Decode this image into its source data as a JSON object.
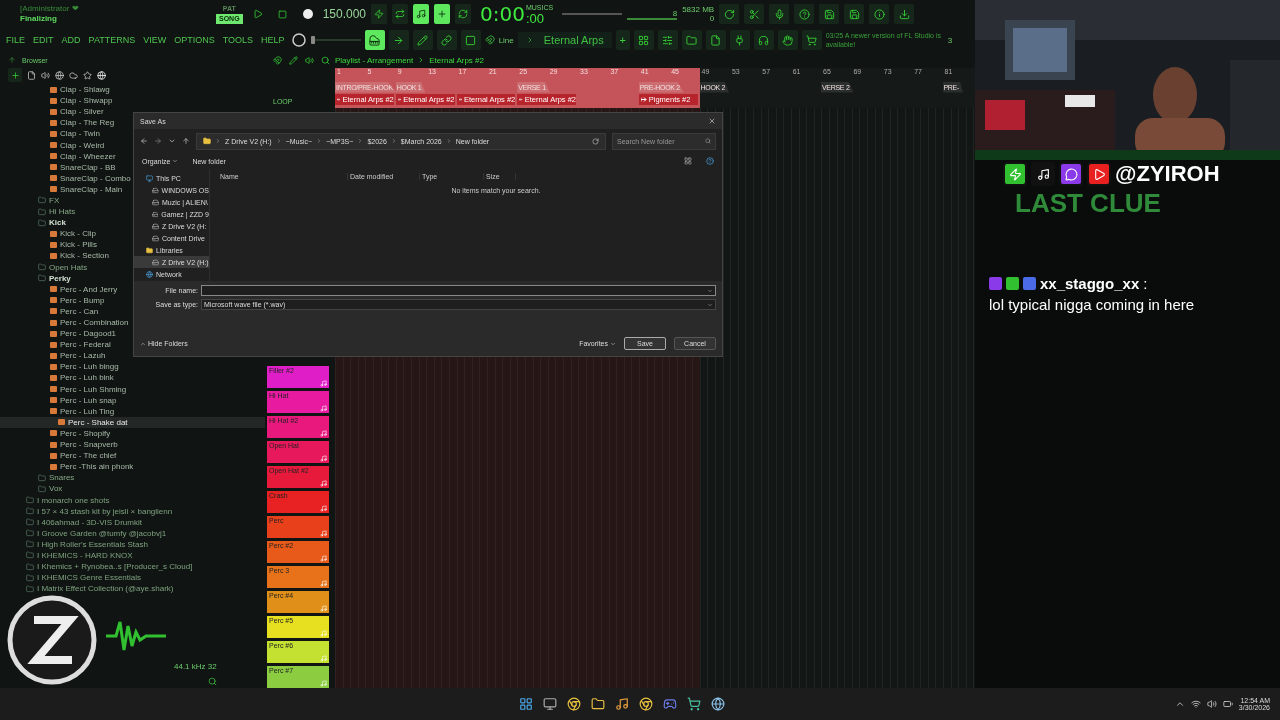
{
  "titlebar": {
    "user": "[Administrator ❤",
    "status": "Finalizing"
  },
  "transport": {
    "modes": [
      {
        "label": "PAT",
        "selected": false
      },
      {
        "label": "SONG",
        "selected": true
      }
    ],
    "tempo": "150.000",
    "time": "0:00",
    "time_small": ":00",
    "time_label": "MUSICS",
    "master_volume": {
      "level": 1
    },
    "cpu": "8",
    "memory": "5832 MB",
    "poly": "0"
  },
  "menu": [
    "FILE",
    "EDIT",
    "ADD",
    "PATTERNS",
    "VIEW",
    "OPTIONS",
    "TOOLS",
    "HELP"
  ],
  "toolbar": {
    "pitch": {
      "level": 0
    },
    "snap": "Line",
    "pattern": "Eternal Arps",
    "add": "+",
    "news_date": "03/25",
    "news": "A newer version of FL Studio is available!",
    "news_count": "3"
  },
  "browser": {
    "title": "Browser",
    "tree": [
      {
        "label": "Clap - Shlawg",
        "kind": "file",
        "selected": false
      },
      {
        "label": "Clap - Shwapp",
        "kind": "file",
        "selected": false
      },
      {
        "label": "Clap - Silver",
        "kind": "file",
        "selected": false
      },
      {
        "label": "Clap - The Reg",
        "kind": "file",
        "selected": false
      },
      {
        "label": "Clap - Twin",
        "kind": "file",
        "selected": false
      },
      {
        "label": "Clap - Weird",
        "kind": "file",
        "selected": false
      },
      {
        "label": "Clap - Wheezer",
        "kind": "file",
        "selected": false
      },
      {
        "label": "SnareClap - BB",
        "kind": "file",
        "selected": false
      },
      {
        "label": "SnareClap - Combo",
        "kind": "file",
        "selected": false
      },
      {
        "label": "SnareClap - Main",
        "kind": "file",
        "selected": false
      },
      {
        "label": "FX",
        "kind": "folder",
        "expanded": false
      },
      {
        "label": "Hi Hats",
        "kind": "folder",
        "expanded": false
      },
      {
        "label": "Kick",
        "kind": "folder",
        "expanded": true,
        "children": [
          {
            "label": "Kick - Clip",
            "kind": "file",
            "selected": false
          },
          {
            "label": "Kick - Pills",
            "kind": "file",
            "selected": false
          },
          {
            "label": "Kick - Section",
            "kind": "file",
            "selected": false
          }
        ]
      },
      {
        "label": "Open Hats",
        "kind": "folder",
        "expanded": false
      },
      {
        "label": "Perky",
        "kind": "folder",
        "expanded": true,
        "children": [
          {
            "label": "Perc - And Jerry",
            "kind": "file",
            "selected": false
          },
          {
            "label": "Perc - Bump",
            "kind": "file",
            "selected": false
          },
          {
            "label": "Perc - Can",
            "kind": "file",
            "selected": false
          },
          {
            "label": "Perc - Combination",
            "kind": "file",
            "selected": false
          },
          {
            "label": "Perc - Dagood1",
            "kind": "file",
            "selected": false
          },
          {
            "label": "Perc - Federal",
            "kind": "file",
            "selected": false
          },
          {
            "label": "Perc - Lazuh",
            "kind": "file",
            "selected": false
          },
          {
            "label": "Perc - Luh bingg",
            "kind": "file",
            "selected": false
          },
          {
            "label": "Perc - Luh bink",
            "kind": "file",
            "selected": false
          },
          {
            "label": "Perc - Luh Shming",
            "kind": "file",
            "selected": false
          },
          {
            "label": "Perc - Luh snap",
            "kind": "file",
            "selected": false
          },
          {
            "label": "Perc - Luh Ting",
            "kind": "file",
            "selected": false
          },
          {
            "label": "Perc - Shake dat",
            "kind": "file",
            "selected": true
          },
          {
            "label": "Perc - Shopify",
            "kind": "file",
            "selected": false
          },
          {
            "label": "Perc - Snapverb",
            "kind": "file",
            "selected": false
          },
          {
            "label": "Perc - The chief",
            "kind": "file",
            "selected": false
          },
          {
            "label": "Perc -This ain phonk",
            "kind": "file",
            "selected": false
          }
        ]
      },
      {
        "label": "Snares",
        "kind": "folder",
        "expanded": false
      },
      {
        "label": "Vox",
        "kind": "folder",
        "expanded": false
      },
      {
        "label": "I monarch one shots",
        "kind": "pack"
      },
      {
        "label": "I 57 × 43 stash kit by jeisli × banglienn",
        "kind": "pack"
      },
      {
        "label": "I 406ahmad - 3D-VIS Drumkit",
        "kind": "pack"
      },
      {
        "label": "I Groove Garden @tumfy @jacobvj1",
        "kind": "pack"
      },
      {
        "label": "I High Roller's Essentials Stash",
        "kind": "pack"
      },
      {
        "label": "I KHEMICS - HARD KNOX",
        "kind": "pack"
      },
      {
        "label": "I Khemics + Rynobea..s [Producer_s Cloud]",
        "kind": "pack"
      },
      {
        "label": "I KHEMICS Genre Essentials",
        "kind": "pack"
      },
      {
        "label": "I Matrix Effect Collection (@aye.shark)",
        "kind": "pack"
      }
    ],
    "sample_rate": "44.1 kHz 32"
  },
  "playlist": {
    "title": "Playlist - Arrangement",
    "pattern": "Eternal Arps #2",
    "loop_label": "LOOP",
    "bars": [
      {
        "number": "1",
        "highlighted": true,
        "marker": "INTRO/PRE-HOOK",
        "clip": "Eternal Arps #2"
      },
      {
        "number": "5",
        "highlighted": true
      },
      {
        "number": "9",
        "highlighted": true,
        "marker": "HOOK 1",
        "clip": "Eternal Arps #2"
      },
      {
        "number": "13",
        "highlighted": true
      },
      {
        "number": "17",
        "highlighted": true,
        "clip": "Eternal Arps #2"
      },
      {
        "number": "21",
        "highlighted": true
      },
      {
        "number": "25",
        "highlighted": true,
        "marker": "VERSE 1",
        "clip": "Eternal Arps #2"
      },
      {
        "number": "29",
        "highlighted": true
      },
      {
        "number": "33",
        "highlighted": true
      },
      {
        "number": "37",
        "highlighted": true
      },
      {
        "number": "41",
        "highlighted": true,
        "marker": "PRE-HOOK 2",
        "clip": "Pigments #2"
      },
      {
        "number": "45",
        "highlighted": true
      },
      {
        "number": "49",
        "highlighted": false,
        "marker": "HOOK 2"
      },
      {
        "number": "53",
        "highlighted": false
      },
      {
        "number": "57",
        "highlighted": false
      },
      {
        "number": "61",
        "highlighted": false
      },
      {
        "number": "65",
        "highlighted": false,
        "marker": "VERSE 2"
      },
      {
        "number": "69",
        "highlighted": false
      },
      {
        "number": "73",
        "highlighted": false
      },
      {
        "number": "77",
        "highlighted": false
      },
      {
        "number": "81",
        "highlighted": false,
        "marker": "PRE-"
      }
    ]
  },
  "channels": [
    {
      "name": "Filler #2",
      "color": "#e01ec8"
    },
    {
      "name": "Hi Hat",
      "color": "#e81aa0"
    },
    {
      "name": "Hi Hat #2",
      "color": "#e8187c"
    },
    {
      "name": "Open Hat",
      "color": "#e8185c"
    },
    {
      "name": "Open Hat #2",
      "color": "#e81a3c"
    },
    {
      "name": "Crash",
      "color": "#e82222"
    },
    {
      "name": "Perc",
      "color": "#e8401a"
    },
    {
      "name": "Perc #2",
      "color": "#e85a1a"
    },
    {
      "name": "Perc 3",
      "color": "#e8721a"
    },
    {
      "name": "Perc #4",
      "color": "#e09018"
    },
    {
      "name": "Perc #5",
      "color": "#e6e020"
    },
    {
      "name": "Perc #6",
      "color": "#c4e030"
    },
    {
      "name": "Perc #7",
      "color": "#8ccc40"
    }
  ],
  "dialog": {
    "title": "Save As",
    "path": [
      "Z Drive V2 (H:)",
      "~Music~",
      "~MP3S~",
      "$2026",
      "$March 2026",
      "New folder"
    ],
    "search_placeholder": "Search New folder",
    "organize": "Organize",
    "new_folder": "New folder",
    "nav": [
      {
        "label": "This PC",
        "kind": "pc",
        "selected": false
      },
      {
        "label": "WINDOWS OS",
        "kind": "os",
        "selected": false
      },
      {
        "label": "Muzic | ALIEN\\",
        "kind": "drive",
        "selected": false
      },
      {
        "label": "Gamez | ZZD 9",
        "kind": "drive",
        "selected": false
      },
      {
        "label": "Z Drive V2 (H:",
        "kind": "drive",
        "selected": false
      },
      {
        "label": "Content Drive",
        "kind": "drive",
        "selected": false
      },
      {
        "label": "Libraries",
        "kind": "folder",
        "selected": false
      },
      {
        "label": "Z Drive V2 (H:)",
        "kind": "drive",
        "selected": true
      },
      {
        "label": "Network",
        "kind": "network",
        "selected": false
      }
    ],
    "columns": [
      "Name",
      "Date modified",
      "Type",
      "Size"
    ],
    "empty": "No items match your search.",
    "file_name_label": "File name:",
    "save_type_label": "Save as type:",
    "save_type": "Microsoft wave file (*.wav)",
    "hide_folders": "Hide Folders",
    "favorites": "Favorites",
    "save": "Save",
    "cancel": "Cancel"
  },
  "stream": {
    "handle": "@ZYIROH",
    "backdrop": "LAST CLUE",
    "chat": {
      "user": "xx_staggo_xx",
      "separator": ":",
      "message": "lol typical nigga coming in here"
    }
  },
  "taskbar": {
    "time": "12:54 AM",
    "date": "3/30/2026"
  }
}
